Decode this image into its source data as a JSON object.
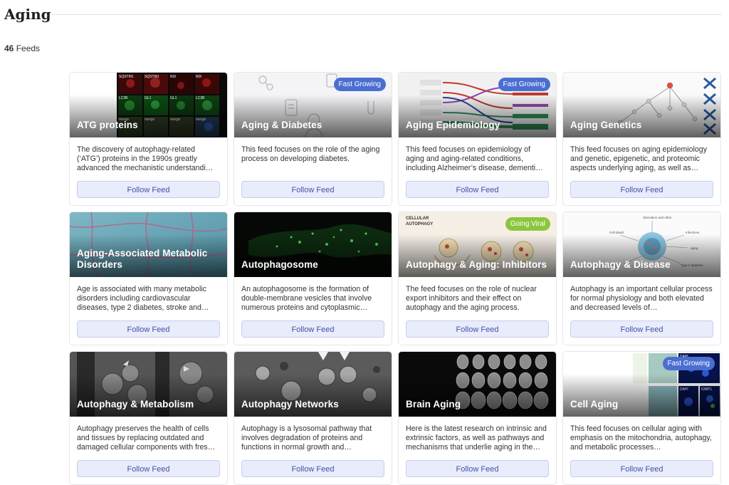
{
  "page": {
    "title": "Aging",
    "feed_count": "46",
    "feed_count_label": "Feeds"
  },
  "button_label": "Follow Feed",
  "colors": {
    "badge_fast": "#4a6fd1",
    "badge_viral": "#8cc63f",
    "button_bg": "#e9ecfb",
    "button_text": "#4452a3"
  },
  "cards": [
    {
      "title": "ATG proteins",
      "badge": "",
      "description": "The discovery of autophagy-related (‘ATG’) proteins in the 1990s greatly advanced the mechanistic understandi…",
      "image": "immunofluorescence-grid"
    },
    {
      "title": "Aging & Diabetes",
      "badge": "Fast Growing",
      "description": "This feed focuses on the role of the aging process on developing diabetes.",
      "image": "medical-icons-outline"
    },
    {
      "title": "Aging Epidemiology",
      "badge": "Fast Growing",
      "description": "This feed focuses on epidemiology of aging and aging-related conditions, including Alzheimer’s disease, dementi…",
      "image": "flow-diagram"
    },
    {
      "title": "Aging Genetics",
      "badge": "",
      "description": "This feed focuses on aging epidemiology and genetic, epigenetic, and proteomic aspects underlying aging, as well as…",
      "image": "genetics-diagram"
    },
    {
      "title": "Aging-Associated Metabolic Disorders",
      "badge": "",
      "description": "Age is associated with many metabolic disorders including cardiovascular diseases, type 2 diabetes, stroke and…",
      "image": "tissue-histology"
    },
    {
      "title": "Autophagosome",
      "badge": "",
      "description": "An autophagosome is the formation of double-membrane vesicles that involve numerous proteins and cytoplasmic…",
      "image": "green-fluorescence"
    },
    {
      "title": "Autophagy & Aging: Inhibitors",
      "badge": "Going Viral",
      "description": "The feed focuses on the role of nuclear export inhibitors and their effect on autophagy and the aging process.",
      "image": "cellular-autophagy-diagram"
    },
    {
      "title": "Autophagy & Disease",
      "badge": "",
      "description": "Autophagy is an important cellular process for normal physiology and both elevated and decreased levels of…",
      "image": "cell-disease-diagram"
    },
    {
      "title": "Autophagy & Metabolism",
      "badge": "",
      "description": "Autophagy preserves the health of cells and tissues by replacing outdated and damaged cellular components with fres…",
      "image": "electron-micrograph"
    },
    {
      "title": "Autophagy Networks",
      "badge": "",
      "description": "Autophagy is a lysosomal pathway that involves degradation of proteins and functions in normal growth and…",
      "image": "electron-micrograph-arrows"
    },
    {
      "title": "Brain Aging",
      "badge": "",
      "description": "Here is the latest research on intrinsic and extrinsic factors, as well as pathways and mechanisms that underlie aging in the…",
      "image": "brain-mri-scans"
    },
    {
      "title": "Cell Aging",
      "badge": "Fast Growing",
      "description": "This feed focuses on cellular aging with emphasis on the mitochondria, autophagy, and metabolic processes…",
      "image": "cell-staining-panels"
    }
  ]
}
